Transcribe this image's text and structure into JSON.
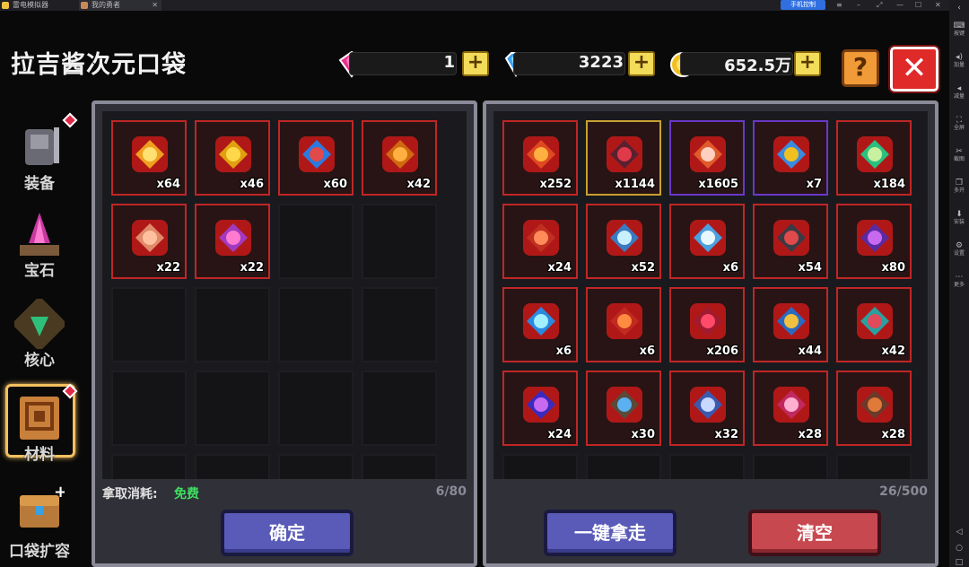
{
  "window": {
    "tab1": "雷电模拟器",
    "tab2": "我的勇者",
    "phone_control": "手机控制"
  },
  "right_sidebar": [
    {
      "icon": "keyboard-icon",
      "label": "按键"
    },
    {
      "icon": "volume-up-icon",
      "label": "加量"
    },
    {
      "icon": "volume-down-icon",
      "label": "减量"
    },
    {
      "icon": "fullscreen-icon",
      "label": "全屏"
    },
    {
      "icon": "scissors-icon",
      "label": "截图"
    },
    {
      "icon": "multi-window-icon",
      "label": "多开"
    },
    {
      "icon": "install-icon",
      "label": "安装"
    },
    {
      "icon": "settings-icon",
      "label": "设置"
    },
    {
      "icon": "more-icon",
      "label": "更多"
    }
  ],
  "title": "拉吉酱次元口袋",
  "currencies": {
    "pink_gem": "1",
    "blue_diamond": "3223",
    "gold": "652.5万"
  },
  "tabs": [
    {
      "label": "装备",
      "icon": "armor-icon",
      "badge": true,
      "active": false
    },
    {
      "label": "宝石",
      "icon": "crystal-icon",
      "badge": false,
      "active": false
    },
    {
      "label": "核心",
      "icon": "core-icon",
      "badge": false,
      "active": false
    },
    {
      "label": "材料",
      "icon": "materials-icon",
      "badge": true,
      "active": true
    },
    {
      "label": "口袋扩容",
      "icon": "chest-icon",
      "badge": false,
      "active": false
    }
  ],
  "left_panel": {
    "items": [
      {
        "icon": "golden-ring-icon",
        "qty": "x64"
      },
      {
        "icon": "gold-nugget-icon",
        "qty": "x46"
      },
      {
        "icon": "blue-orb-icon",
        "qty": "x60"
      },
      {
        "icon": "amber-scroll-icon",
        "qty": "x42"
      },
      {
        "icon": "pig-face-icon",
        "qty": "x22"
      },
      {
        "icon": "purple-charm-icon",
        "qty": "x22"
      }
    ],
    "cost_label": "拿取消耗:",
    "cost_value": "免费",
    "capacity": "6/80",
    "confirm": "确定"
  },
  "right_panel": {
    "items": [
      {
        "icon": "fire-crystal-icon",
        "qty": "x252",
        "rarity": "red"
      },
      {
        "icon": "dark-crystal-icon",
        "qty": "x1144",
        "rarity": "gold"
      },
      {
        "icon": "orange-gem-icon",
        "qty": "x1605",
        "rarity": "purple"
      },
      {
        "icon": "rainbow-crystal-icon",
        "qty": "x7",
        "rarity": "purple"
      },
      {
        "icon": "green-fang-icon",
        "qty": "x184",
        "rarity": "red"
      },
      {
        "icon": "red-flower-icon",
        "qty": "x24",
        "rarity": "red"
      },
      {
        "icon": "ice-axe-icon",
        "qty": "x52",
        "rarity": "red"
      },
      {
        "icon": "snowflake-icon",
        "qty": "x6",
        "rarity": "red"
      },
      {
        "icon": "dark-axe-icon",
        "qty": "x54",
        "rarity": "red"
      },
      {
        "icon": "purple-axe-icon",
        "qty": "x80",
        "rarity": "red"
      },
      {
        "icon": "blue-sword-icon",
        "qty": "x6",
        "rarity": "red"
      },
      {
        "icon": "fire-axe-icon",
        "qty": "x6",
        "rarity": "red"
      },
      {
        "icon": "red-wings-icon",
        "qty": "x206",
        "rarity": "red"
      },
      {
        "icon": "orbit-bow-icon",
        "qty": "x44",
        "rarity": "red"
      },
      {
        "icon": "teal-axe-icon",
        "qty": "x42",
        "rarity": "red"
      },
      {
        "icon": "purple-orb-icon",
        "qty": "x24",
        "rarity": "red"
      },
      {
        "icon": "rune-tablet-icon",
        "qty": "x30",
        "rarity": "red"
      },
      {
        "icon": "blue-blade-icon",
        "qty": "x32",
        "rarity": "red"
      },
      {
        "icon": "pink-sword-icon",
        "qty": "x28",
        "rarity": "red"
      },
      {
        "icon": "rust-shield-icon",
        "qty": "x28",
        "rarity": "red"
      }
    ],
    "capacity": "26/500",
    "take_all": "一键拿走",
    "clear": "清空"
  },
  "colors": {
    "slot_border": "#c02626",
    "gold_border": "#c8a030",
    "purple_border": "#6a38c8",
    "free_text": "#3ee060",
    "panel_bg": "#303038"
  }
}
